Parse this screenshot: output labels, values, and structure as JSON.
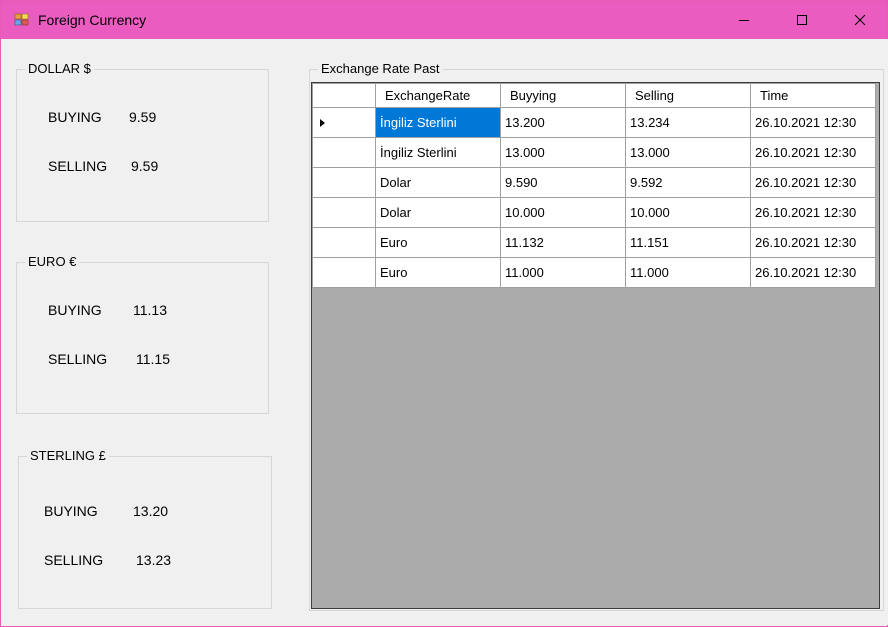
{
  "window": {
    "title": "Foreign Currency",
    "controls": {
      "minimize": "minimize",
      "maximize": "maximize",
      "close": "close"
    }
  },
  "dollar": {
    "legend": "DOLLAR $",
    "buying_label": "BUYING",
    "buying_value": "9.59",
    "selling_label": "SELLING",
    "selling_value": "9.59"
  },
  "euro": {
    "legend": "EURO €",
    "buying_label": "BUYING",
    "buying_value": "11.13",
    "selling_label": "SELLING",
    "selling_value": "11.15"
  },
  "sterling": {
    "legend": "STERLING £",
    "buying_label": "BUYING",
    "buying_value": "13.20",
    "selling_label": "SELLING",
    "selling_value": "13.23"
  },
  "history": {
    "legend": "Exchange Rate Past",
    "columns": [
      "ExchangeRate",
      "Buyying",
      "Selling",
      "Time"
    ],
    "rows": [
      [
        "İngiliz Sterlini",
        "13.200",
        "13.234",
        "26.10.2021 12:30"
      ],
      [
        "İngiliz Sterlini",
        "13.000",
        "13.000",
        "26.10.2021 12:30"
      ],
      [
        "Dolar",
        "9.590",
        "9.592",
        "26.10.2021 12:30"
      ],
      [
        "Dolar",
        "10.000",
        "10.000",
        "26.10.2021 12:30"
      ],
      [
        "Euro",
        "11.132",
        "11.151",
        "26.10.2021 12:30"
      ],
      [
        "Euro",
        "11.000",
        "11.000",
        "26.10.2021 12:30"
      ]
    ]
  },
  "colors": {
    "titlebar": "#ea5cc0",
    "selection": "#0078d7",
    "grid_background": "#ababab"
  }
}
